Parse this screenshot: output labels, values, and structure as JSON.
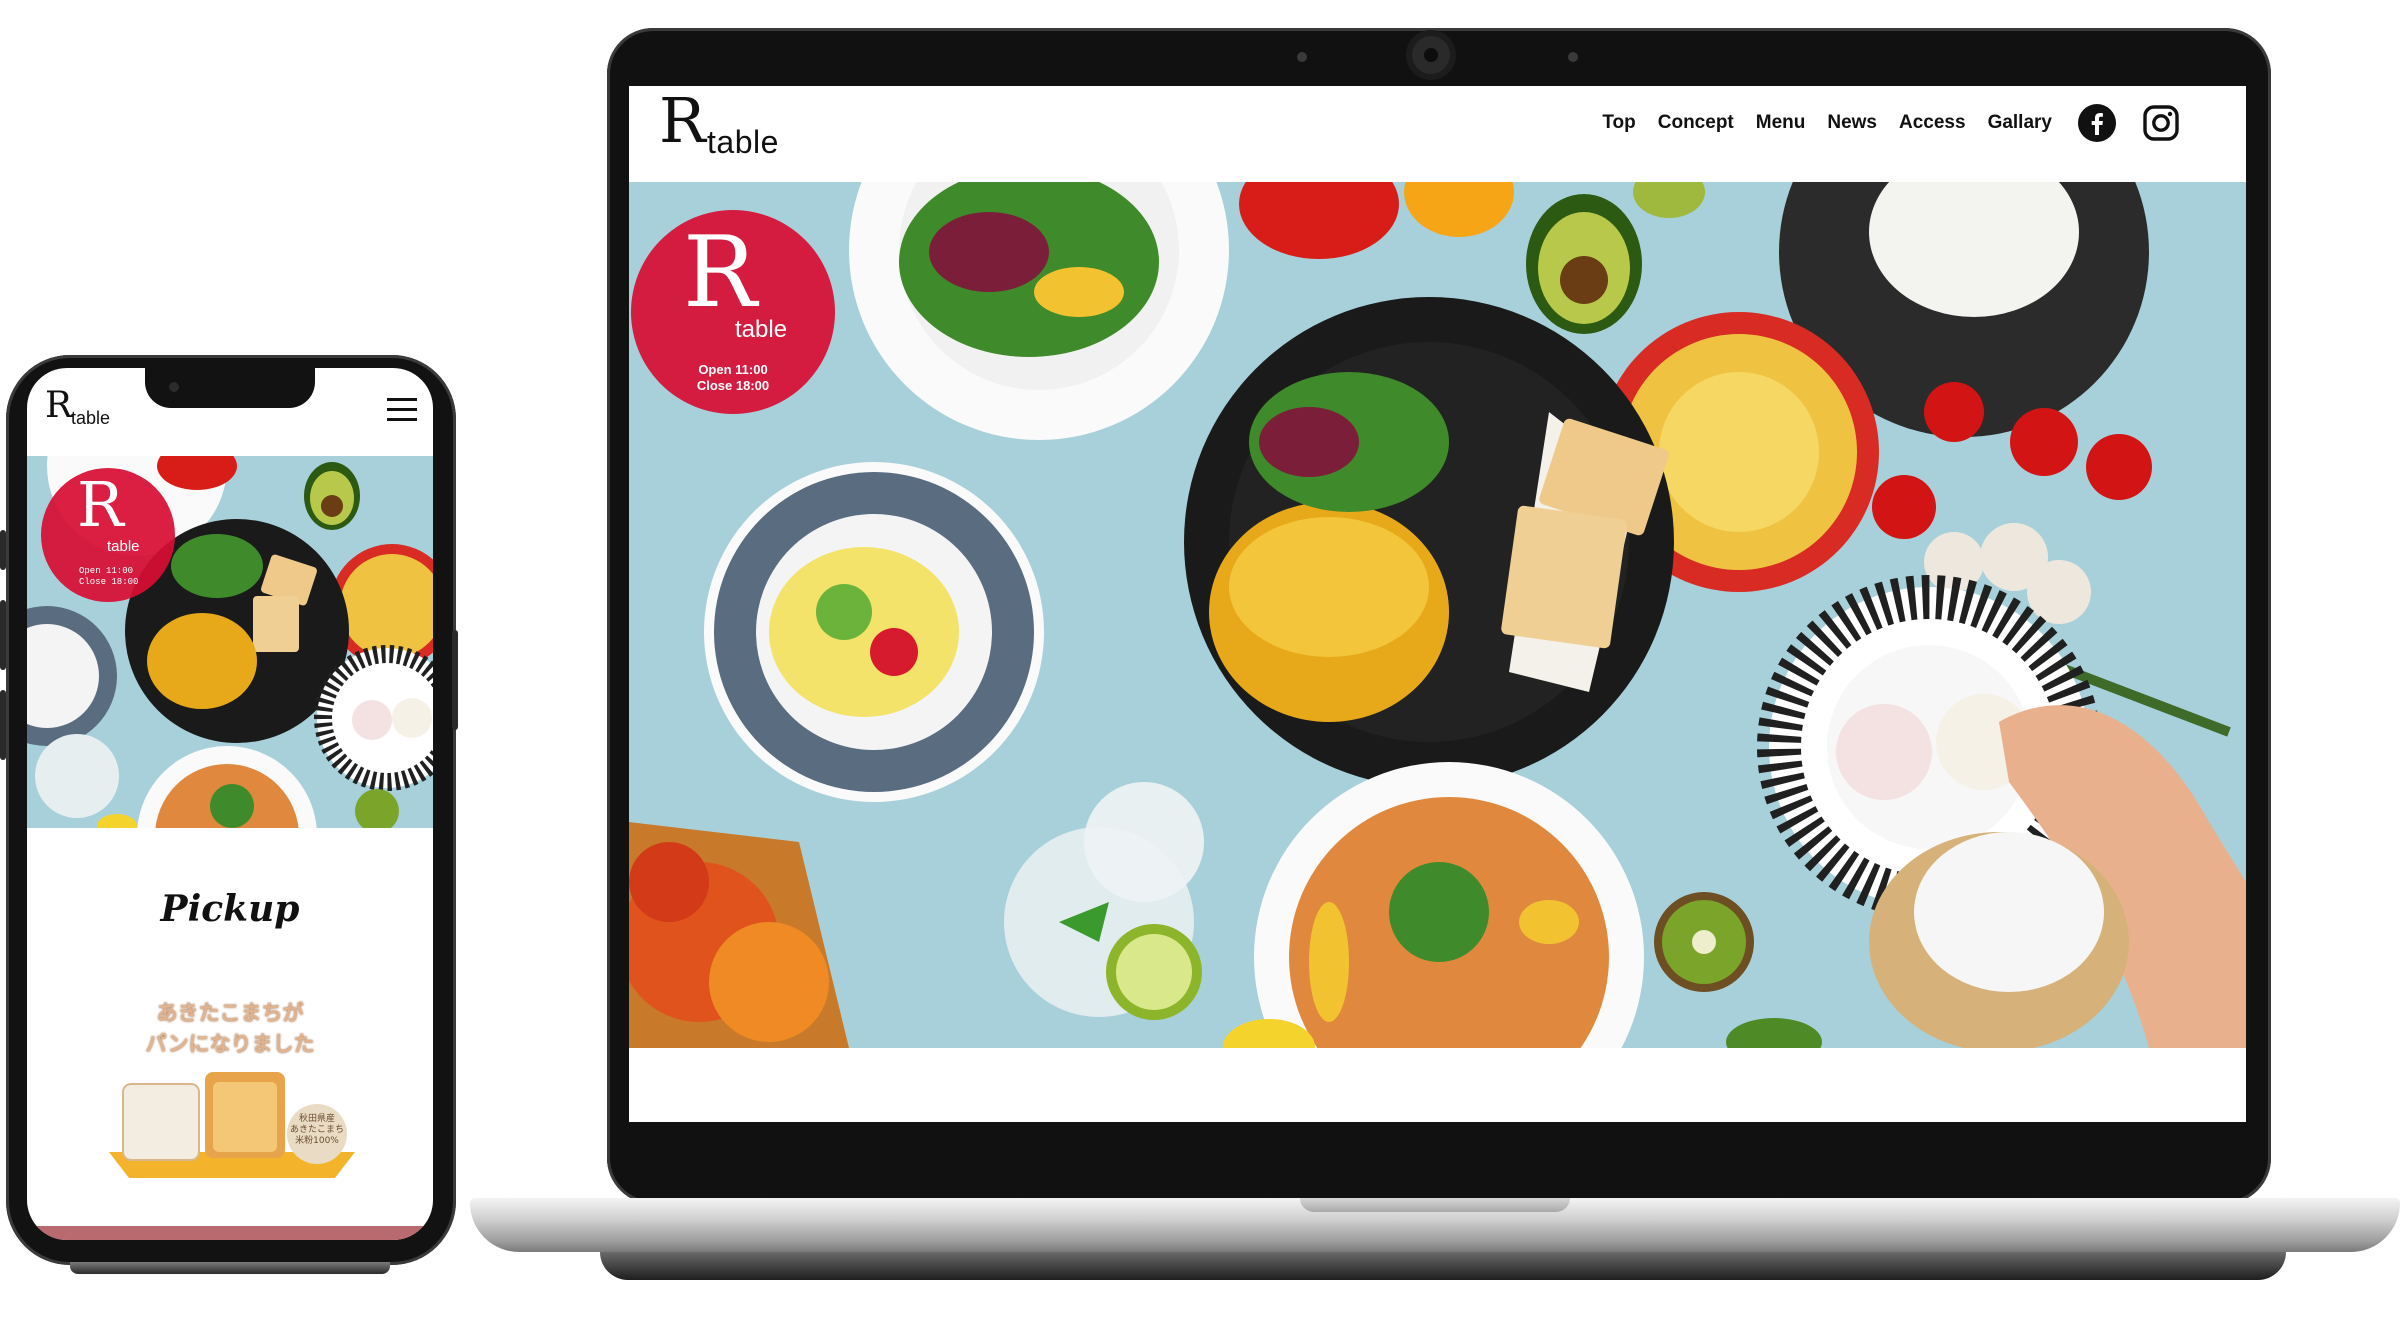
{
  "site": {
    "logo_initial": "R",
    "logo_word": "table",
    "nav": [
      "Top",
      "Concept",
      "Menu",
      "News",
      "Access",
      "Gallary"
    ],
    "social": [
      "facebook-icon",
      "instagram-icon"
    ],
    "hours_open": "Open 11:00",
    "hours_close": "Close 18:00",
    "accent_color": "#d70e34"
  },
  "mobile": {
    "pickup_title": "Pickup",
    "pickup_line1": "あきたこまちが",
    "pickup_line2": "パンになりました",
    "bread_badge_line1": "秋田県産",
    "bread_badge_line2": "あきたこまち",
    "bread_badge_line3": "米粉100%",
    "menu_icon": "hamburger-icon"
  }
}
